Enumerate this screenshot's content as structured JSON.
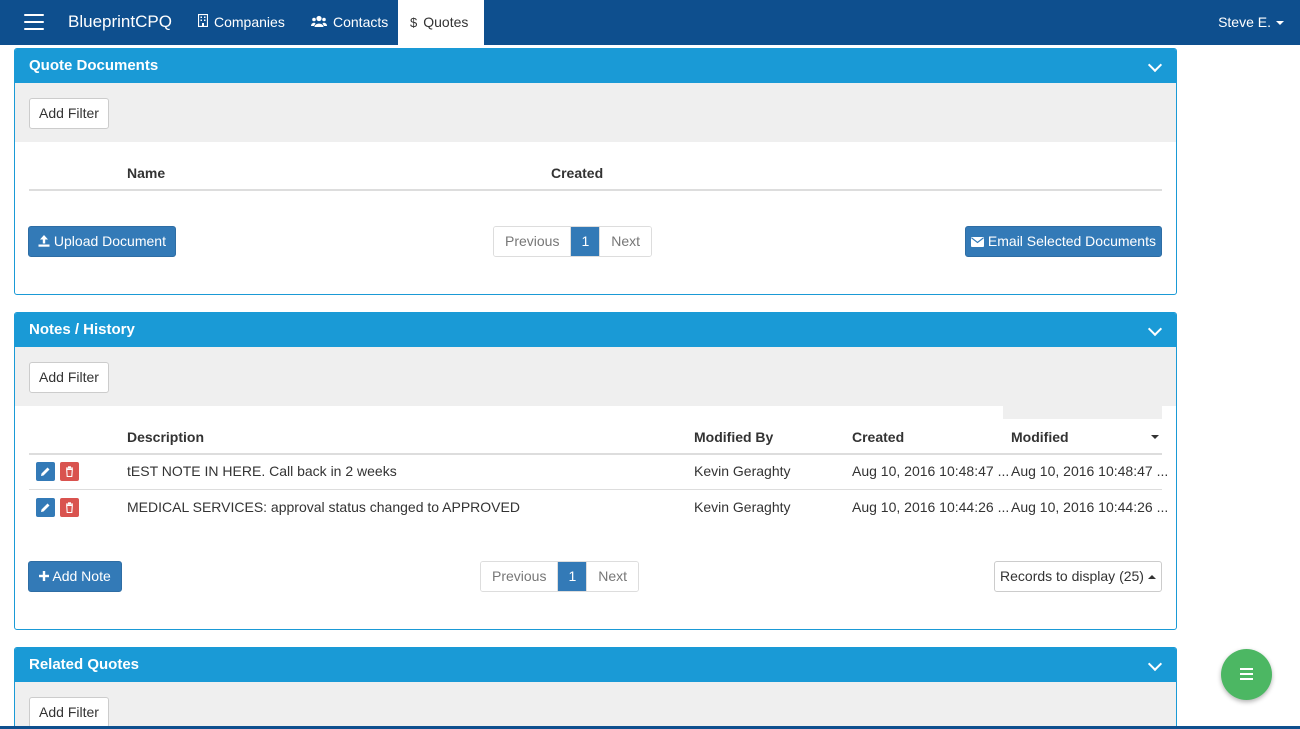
{
  "navbar": {
    "brand": "BlueprintCPQ",
    "items": [
      {
        "label": "Companies",
        "icon": "building-icon"
      },
      {
        "label": "Contacts",
        "icon": "users-icon"
      },
      {
        "label": "Quotes",
        "icon": "dollar-icon",
        "active": true
      }
    ],
    "user": "Steve E."
  },
  "quote_documents": {
    "title": "Quote Documents",
    "add_filter": "Add Filter",
    "columns": [
      "Name",
      "Created"
    ],
    "upload_button": "Upload Document",
    "email_button": "Email Selected Documents",
    "pager": {
      "previous": "Previous",
      "page": "1",
      "next": "Next"
    }
  },
  "notes_history": {
    "title": "Notes / History",
    "add_filter": "Add Filter",
    "columns": [
      "Description",
      "Modified By",
      "Created",
      "Modified"
    ],
    "rows": [
      {
        "description": "tEST NOTE IN HERE. Call back in 2 weeks",
        "modified_by": "Kevin Geraghty",
        "created": "Aug 10, 2016 10:48:47 ...",
        "modified": "Aug 10, 2016 10:48:47 ..."
      },
      {
        "description": "MEDICAL SERVICES: approval status changed to APPROVED",
        "modified_by": "Kevin Geraghty",
        "created": "Aug 10, 2016 10:44:26 ...",
        "modified": "Aug 10, 2016 10:44:26 ..."
      }
    ],
    "add_note_button": "Add Note",
    "pager": {
      "previous": "Previous",
      "page": "1",
      "next": "Next"
    },
    "records_display": "Records to display (25)"
  },
  "related_quotes": {
    "title": "Related Quotes",
    "add_filter": "Add Filter"
  },
  "colors": {
    "nav": "#0e4f8e",
    "panel_header": "#1a9ad6",
    "primary": "#337ab7",
    "danger": "#d9534f",
    "fab": "#4cb763"
  }
}
